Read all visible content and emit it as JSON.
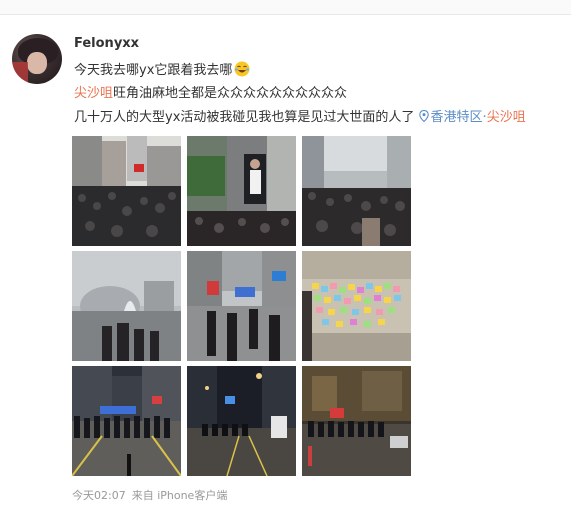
{
  "post": {
    "username": "Felonyxx",
    "line1": "今天我去哪yx它跟着我去哪",
    "line2_link": "尖沙咀",
    "line2_rest": "旺角油麻地全都是",
    "line2_icons": "众众众众众众众众众众",
    "line3_text": "几十万人的大型yx活动被我碰见我也算是见过大世面的人了",
    "location_region": "香港特区",
    "location_sep": "·",
    "location_place": "尖沙咀",
    "timestamp": "今天02:07",
    "source": "来自 iPhone客户端"
  },
  "photos": [
    "photo-crowd-street-1",
    "photo-crowd-billboard",
    "photo-crowd-street-2",
    "photo-harbour-dome",
    "photo-street-protesters",
    "photo-lennon-wall",
    "photo-night-police-line-1",
    "photo-night-street",
    "photo-night-police-line-2"
  ]
}
